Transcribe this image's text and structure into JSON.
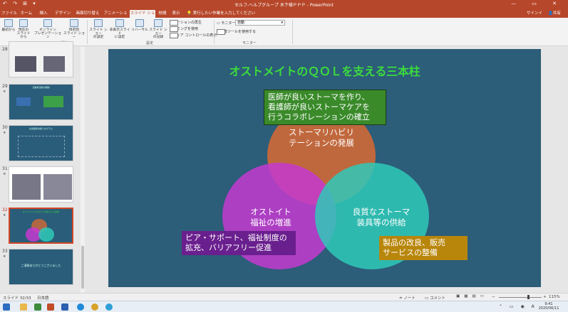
{
  "window": {
    "quick_access": "↶ ↷ ⊞ ▾",
    "title": "セルフ-ヘルプグループ 木下様ＰＰＰ - PowerPoint",
    "controls": "— ▭ ✕"
  },
  "tabs": [
    "ファイル",
    "ホーム",
    "挿入",
    "デザイン",
    "画面切り替え",
    "アニメーション",
    "スライド ショー",
    "校閲",
    "表示"
  ],
  "tell_me": "実行したい作業を入力してください",
  "user": {
    "signin": "サインイン",
    "share": "共有"
  },
  "ribbon": {
    "btn_from_start": "最初から",
    "btn_from_current": "現在の\nスライドから",
    "btn_online": "オンライン\nプレゼンテーション",
    "btn_custom": "目的別\nスライド ショー",
    "group_start": "スライド ショーの開始",
    "btn_setup": "スライド ショー\nの設定",
    "btn_hide": "非表示スライド\nに設定",
    "btn_rehearse": "リハーサル",
    "btn_record": "スライド ショー\nの記録",
    "chk_narration": "ナレーションの再生",
    "chk_timing": "タイミングを使用",
    "chk_media": "メディア コントロールの表示",
    "group_setup": "設定",
    "monitor_label": "モニター:",
    "monitor_value": "自動",
    "chk_presenter": "発表者ツールを使用する",
    "group_monitor": "モニター"
  },
  "thumbnails": [
    {
      "num": "28",
      "text": ""
    },
    {
      "num": "29",
      "text": "当事者活動の展開"
    },
    {
      "num": "30",
      "text": "社会復帰支援プログラム"
    },
    {
      "num": "31",
      "text": ""
    },
    {
      "num": "32",
      "text": "オストメイトのＱＯＬを支える三本柱"
    },
    {
      "num": "33",
      "text": "ご清聴ありがとうございました"
    }
  ],
  "slide": {
    "title": "オストメイトのＱＯＬを支える三本柱",
    "top_circle": "ストーマリハビリ\nテーションの発展",
    "left_circle": "オストイト\n福祉の増進",
    "right_circle": "良質なストーマ\n装具等の供給",
    "green_box": "医師が良いストーマを作り、\n看護師が良いストーマケアを\n行うコラボレーションの確立",
    "purple_box": "ピア・サポート、福祉制度の\n拡充、バリアフリー促進",
    "orange_box": "製品の改良、販売\nサービスの整備"
  },
  "colors": {
    "accent": "#b7472a",
    "slide_bg": "#2c5d79",
    "title_green": "#3cdc3c",
    "top_circle": "#c8683a",
    "left_circle": "#c43ad0",
    "right_circle": "#2fc9b8",
    "green_box": "#3a8a2a",
    "purple_box": "#6a1f8e",
    "orange_box": "#b8860b"
  },
  "status": {
    "slide_info": "スライド 32/33",
    "language": "日本語",
    "notes": "ノート",
    "comments": "コメント",
    "zoom": "115%"
  },
  "taskbar": {
    "time": "9:41",
    "date": "2020/06/11"
  }
}
